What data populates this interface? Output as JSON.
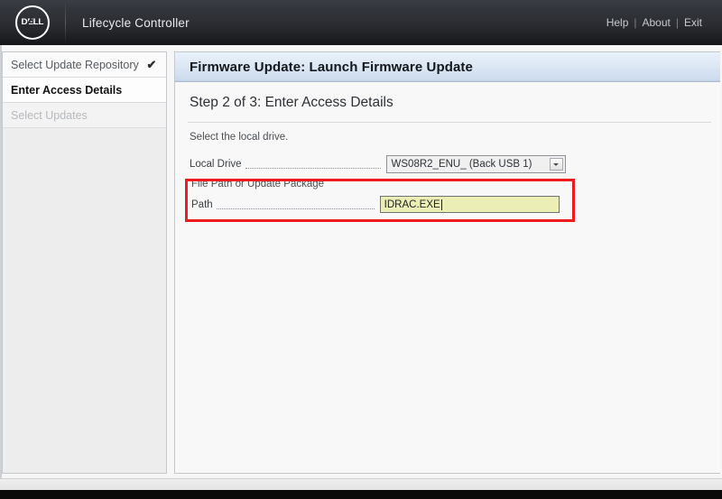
{
  "header": {
    "logo_alt": "DELL",
    "app_title": "Lifecycle Controller",
    "links": [
      {
        "label": "Help"
      },
      {
        "label": "About"
      },
      {
        "label": "Exit"
      }
    ],
    "separator": "|"
  },
  "sidebar": {
    "items": [
      {
        "label": "Select Update Repository",
        "state": "done",
        "check": "✔"
      },
      {
        "label": "Enter Access Details",
        "state": "active",
        "check": ""
      },
      {
        "label": "Select Updates",
        "state": "disabled",
        "check": ""
      }
    ]
  },
  "content": {
    "panel_title": "Firmware Update: Launch Firmware Update",
    "step_title": "Step 2 of 3: Enter  Access Details",
    "instruction": "Select the local drive.",
    "form": {
      "local_drive": {
        "label": "Local Drive",
        "value": "WS08R2_ENU_ (Back USB 1)",
        "options": [
          "WS08R2_ENU_ (Back USB 1)"
        ]
      },
      "group": {
        "legend": "File Path or Update Package",
        "path": {
          "label": "Path",
          "value": "IDRAC.EXE",
          "placeholder": ""
        }
      }
    },
    "highlight_color": "#ee1c1c"
  }
}
